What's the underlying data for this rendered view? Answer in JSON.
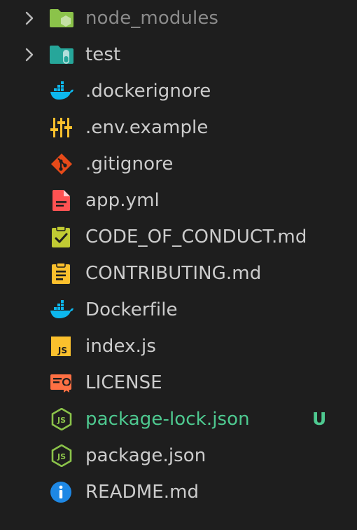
{
  "explorer": {
    "items": [
      {
        "label": "node_modules",
        "icon": "node-modules-folder-icon",
        "type": "folder",
        "dimmed": true
      },
      {
        "label": "test",
        "icon": "test-folder-icon",
        "type": "folder"
      },
      {
        "label": ".dockerignore",
        "icon": "docker-icon",
        "type": "file"
      },
      {
        "label": ".env.example",
        "icon": "settings-sliders-icon",
        "type": "file"
      },
      {
        "label": ".gitignore",
        "icon": "git-icon",
        "type": "file"
      },
      {
        "label": "app.yml",
        "icon": "yaml-file-icon",
        "type": "file"
      },
      {
        "label": "CODE_OF_CONDUCT.md",
        "icon": "clipboard-check-icon",
        "type": "file"
      },
      {
        "label": "CONTRIBUTING.md",
        "icon": "clipboard-list-icon",
        "type": "file"
      },
      {
        "label": "Dockerfile",
        "icon": "docker-icon",
        "type": "file"
      },
      {
        "label": "index.js",
        "icon": "javascript-icon",
        "type": "file"
      },
      {
        "label": "LICENSE",
        "icon": "license-certificate-icon",
        "type": "file"
      },
      {
        "label": "package-lock.json",
        "icon": "nodejs-icon",
        "type": "file",
        "git_status": "U"
      },
      {
        "label": "package.json",
        "icon": "nodejs-icon",
        "type": "file"
      },
      {
        "label": "README.md",
        "icon": "info-icon",
        "type": "file"
      }
    ]
  },
  "colors": {
    "background": "#1e1e1e",
    "text": "#cccccc",
    "dimmed_text": "#8b8b8b",
    "untracked": "#4ec990"
  }
}
